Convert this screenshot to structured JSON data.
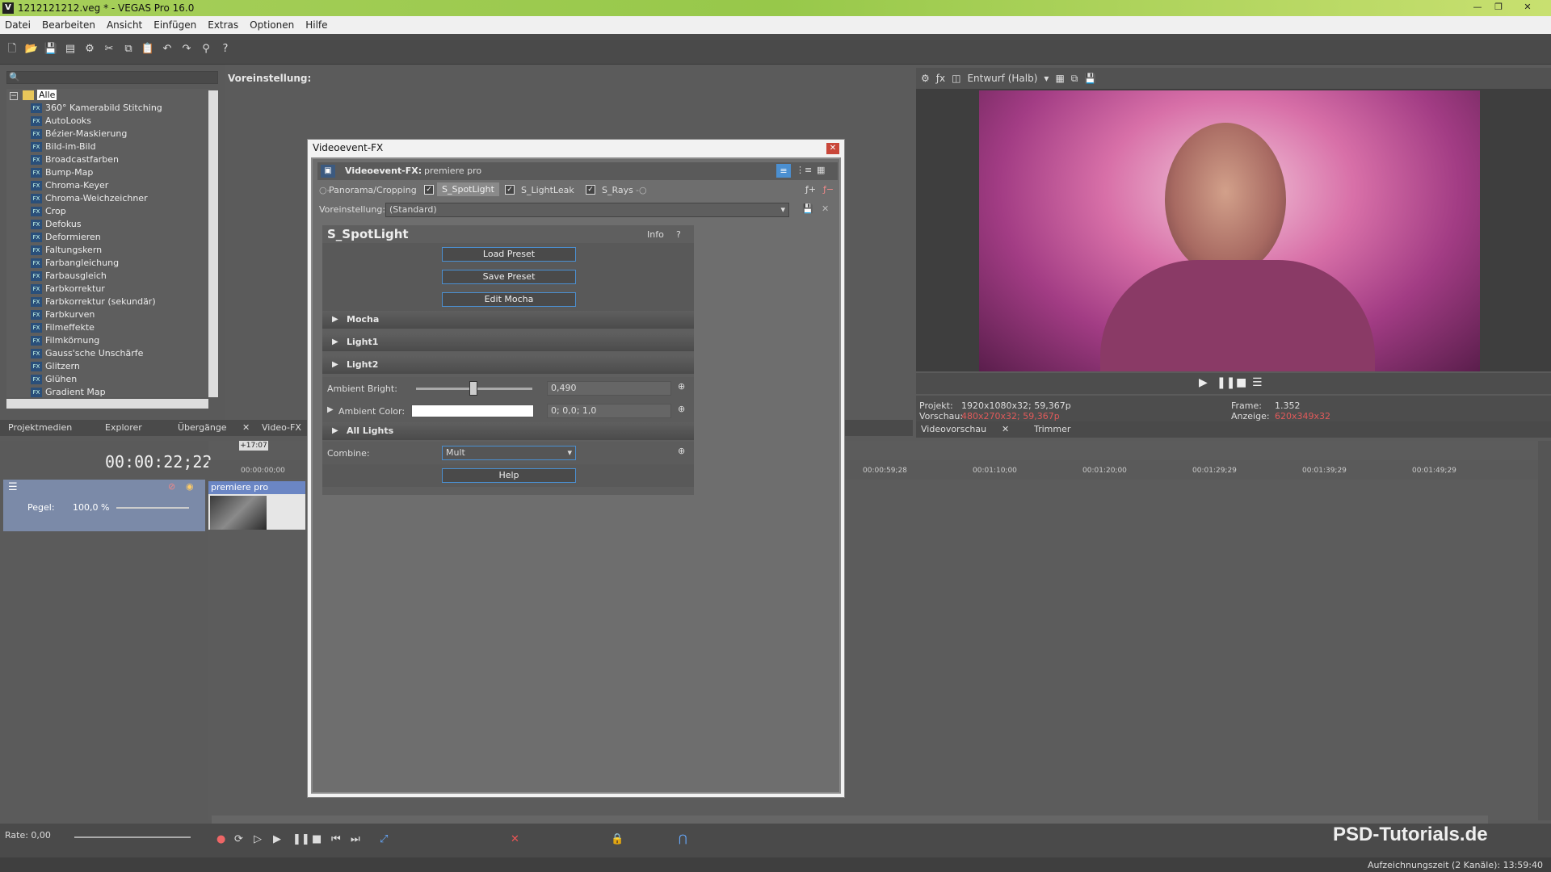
{
  "window": {
    "title": "1212121212.veg * - VEGAS Pro 16.0"
  },
  "menu": [
    "Datei",
    "Bearbeiten",
    "Ansicht",
    "Einfügen",
    "Extras",
    "Optionen",
    "Hilfe"
  ],
  "fx_panel": {
    "root_label": "Alle",
    "items": [
      "360° Kamerabild Stitching",
      "AutoLooks",
      "Bézier-Maskierung",
      "Bild-im-Bild",
      "Broadcastfarben",
      "Bump-Map",
      "Chroma-Keyer",
      "Chroma-Weichzeichner",
      "Crop",
      "Defokus",
      "Deformieren",
      "Faltungskern",
      "Farbangleichung",
      "Farbausgleich",
      "Farbkorrektur",
      "Farbkorrektur (sekundär)",
      "Farbkurven",
      "Filmeffekte",
      "Filmkörnung",
      "Gauss'sche Unschärfe",
      "Glitzern",
      "Glühen",
      "Gradient Map"
    ],
    "preset_label": "Voreinstellung:"
  },
  "panel_tabs": [
    "Projektmedien",
    "Explorer",
    "Übergänge",
    "Video-FX"
  ],
  "preview": {
    "quality": "Entwurf (Halb)",
    "projekt_label": "Projekt:",
    "projekt_value": "1920x1080x32; 59,367p",
    "vorschau_label": "Vorschau:",
    "vorschau_value": "480x270x32; 59,367p",
    "frame_label": "Frame:",
    "frame_value": "1.352",
    "anzeige_label": "Anzeige:",
    "anzeige_value": "620x349x32",
    "tabs": [
      "Videovorschau",
      "Trimmer"
    ]
  },
  "timeline": {
    "timecode": "00:00:22;22",
    "marker": "+17:07",
    "track_level_label": "Pegel:",
    "track_level_value": "100,0 %",
    "clip_name": "premiere pro",
    "ruler_ticks": [
      "00:00:00;00",
      "00:00:59;28",
      "00:01:10;00",
      "00:01:20;00",
      "00:01:29;29",
      "00:01:39;29",
      "00:01:49;29"
    ],
    "rate": "Rate: 0,00"
  },
  "dialog": {
    "title": "Videoevent-FX",
    "header_label": "Videoevent-FX:",
    "header_value": "premiere pro",
    "chain": [
      "Panorama/Cropping",
      "S_SpotLight",
      "S_LightLeak",
      "S_Rays"
    ],
    "preset_label": "Voreinstellung:",
    "preset_value": "(Standard)",
    "plugin_title": "S_SpotLight",
    "info_label": "Info",
    "help_q": "?",
    "buttons": {
      "load": "Load Preset",
      "save": "Save Preset",
      "edit": "Edit Mocha",
      "help": "Help"
    },
    "sections": [
      "Mocha",
      "Light1",
      "Light2",
      "All Lights"
    ],
    "params": {
      "ambient_bright_label": "Ambient Bright:",
      "ambient_bright_value": "0,490",
      "ambient_bright_level": 0.49,
      "ambient_color_label": "Ambient Color:",
      "ambient_color_value": "0; 0,0; 1,0",
      "combine_label": "Combine:",
      "combine_value": "Mult"
    }
  },
  "status": {
    "recording_time": "Aufzeichnungszeit (2 Kanäle): 13:59:40"
  },
  "watermark": "PSD-Tutorials.de",
  "colors": {
    "accent_blue": "#4b8fd0",
    "titlebar_green": "#9bcb4e",
    "preview_red": "#e05a5a"
  }
}
